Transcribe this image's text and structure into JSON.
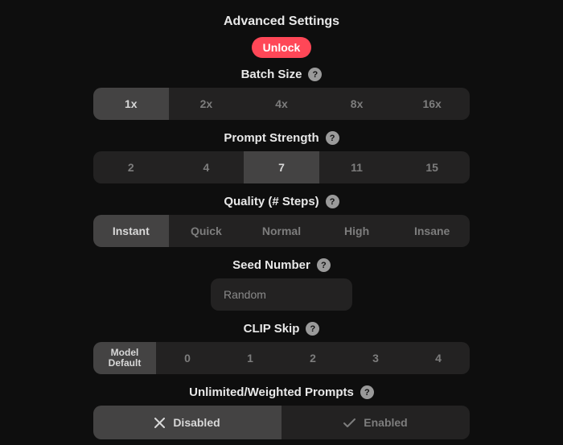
{
  "title": "Advanced Settings",
  "unlock_label": "Unlock",
  "batch_size": {
    "label": "Batch Size",
    "options": [
      "1x",
      "2x",
      "4x",
      "8x",
      "16x"
    ],
    "selected": "1x"
  },
  "prompt_strength": {
    "label": "Prompt Strength",
    "options": [
      "2",
      "4",
      "7",
      "11",
      "15"
    ],
    "selected": "7"
  },
  "quality": {
    "label": "Quality (# Steps)",
    "options": [
      "Instant",
      "Quick",
      "Normal",
      "High",
      "Insane"
    ],
    "selected": "Instant"
  },
  "seed": {
    "label": "Seed Number",
    "placeholder": "Random",
    "value": ""
  },
  "clip_skip": {
    "label": "CLIP Skip",
    "options": [
      "Model Default",
      "0",
      "1",
      "2",
      "3",
      "4"
    ],
    "selected": "Model Default"
  },
  "weighted_prompts": {
    "label": "Unlimited/Weighted Prompts",
    "disabled_label": "Disabled",
    "enabled_label": "Enabled",
    "selected": "Disabled"
  }
}
